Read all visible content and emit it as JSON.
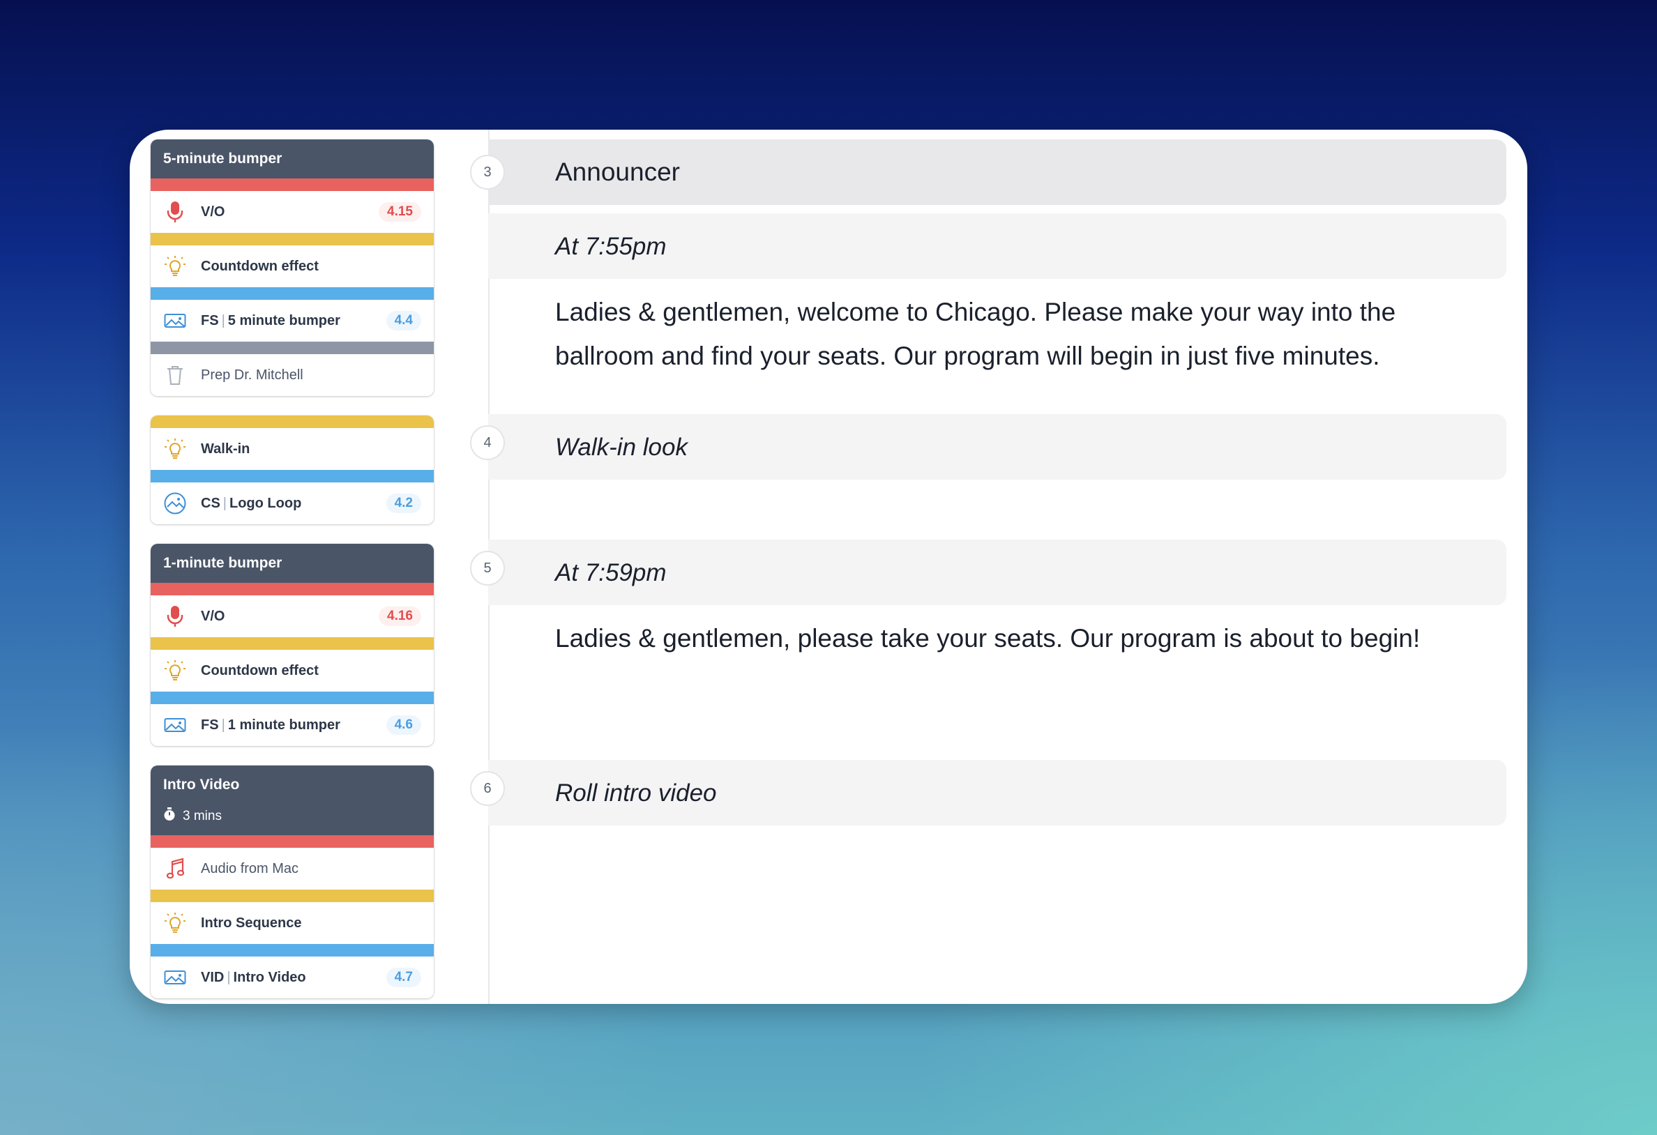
{
  "cues": [
    {
      "title": "5-minute bumper",
      "rows": [
        {
          "bar": "red",
          "icon": "microphone-icon",
          "label": "V/O",
          "badge": "4.15",
          "badge_color": "red"
        },
        {
          "bar": "yellow",
          "icon": "lightbulb-icon",
          "label": "Countdown effect"
        },
        {
          "bar": "blue",
          "icon": "image-icon",
          "prefix": "FS",
          "label": "5 minute bumper",
          "badge": "4.4",
          "badge_color": "blue"
        },
        {
          "bar": "gray",
          "icon": "trash-icon",
          "label": "Prep Dr. Mitchell",
          "light": true
        }
      ]
    },
    {
      "rows": [
        {
          "bar": "yellow",
          "icon": "lightbulb-icon",
          "label": "Walk-in"
        },
        {
          "bar": "blue",
          "icon": "loop-image-icon",
          "prefix": "CS",
          "label": "Logo Loop",
          "badge": "4.2",
          "badge_color": "blue"
        }
      ]
    },
    {
      "title": "1-minute bumper",
      "rows": [
        {
          "bar": "red",
          "icon": "microphone-icon",
          "label": "V/O",
          "badge": "4.16",
          "badge_color": "red"
        },
        {
          "bar": "yellow",
          "icon": "lightbulb-icon",
          "label": "Countdown effect"
        },
        {
          "bar": "blue",
          "icon": "image-icon",
          "prefix": "FS",
          "label": "1 minute bumper",
          "badge": "4.6",
          "badge_color": "blue"
        }
      ]
    },
    {
      "title": "Intro Video",
      "duration": "3 mins",
      "rows": [
        {
          "bar": "red",
          "icon": "music-note-icon",
          "label": "Audio from Mac",
          "light": true
        },
        {
          "bar": "yellow",
          "icon": "lightbulb-icon",
          "label": "Intro Sequence"
        },
        {
          "bar": "blue",
          "icon": "image-icon",
          "prefix": "VID",
          "label": "Intro Video",
          "badge": "4.7",
          "badge_color": "blue"
        }
      ]
    }
  ],
  "script": {
    "sections": [
      {
        "number": "3",
        "heading": "Announcer"
      },
      {
        "cue_time": "At 7:55pm",
        "text": "Ladies & gentlemen, welcome to Chicago. Please make your way into the ballroom and find your seats. Our program will begin in just five minutes."
      },
      {
        "number": "4",
        "heading": "Walk-in look"
      },
      {
        "number": "5",
        "cue_time": "At 7:59pm",
        "text": "Ladies & gentlemen, please take your seats. Our program is about to begin!"
      },
      {
        "number": "6",
        "heading": "Roll intro video"
      }
    ]
  },
  "colors": {
    "red": "#e8625f",
    "yellow": "#ebc24a",
    "blue": "#58aee8",
    "gray": "#8e96a5",
    "header": "#4a5568"
  }
}
